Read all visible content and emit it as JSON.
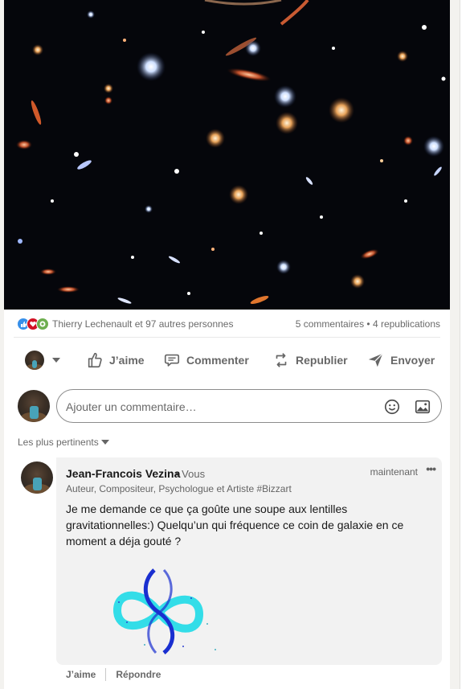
{
  "post": {
    "image_alt": "",
    "icons": {
      "image": "deep-field-galaxy-image"
    }
  },
  "social": {
    "reactions": [
      "like-reaction-icon",
      "love-reaction-icon",
      "support-reaction-icon"
    ],
    "names": "Thierry Lechenault et 97 autres personnes",
    "counts": "5 commentaires • 4 republications"
  },
  "actions": {
    "like": "J’aime",
    "comment": "Commenter",
    "repost": "Republier",
    "send": "Envoyer"
  },
  "composer": {
    "placeholder": "Ajouter un commentaire…",
    "icons": {
      "emoji": "emoji-icon",
      "photo": "photo-icon"
    }
  },
  "sort": {
    "label": "Les plus pertinents"
  },
  "comment": {
    "author": "Jean-Francois Vezina",
    "you_badge": "• Vous",
    "time": "maintenant",
    "more": "•••",
    "headline": "Auteur, Compositeur, Psychologue et Artiste #Bizzart",
    "text": "Je me demande ce que ça goûte une soupe aux lentilles gravitationnelles:) Quelqu’un qui fréquence ce coin de galaxie en ce moment a déja gouté ?",
    "like": "J’aime",
    "reply": "Répondre"
  },
  "colors": {
    "background": "#f3f2ef",
    "card": "#ffffff",
    "comment_bubble": "#f2f2f2",
    "infinity_cyan": "#33dde8",
    "infinity_blue": "#1a2fd0"
  }
}
